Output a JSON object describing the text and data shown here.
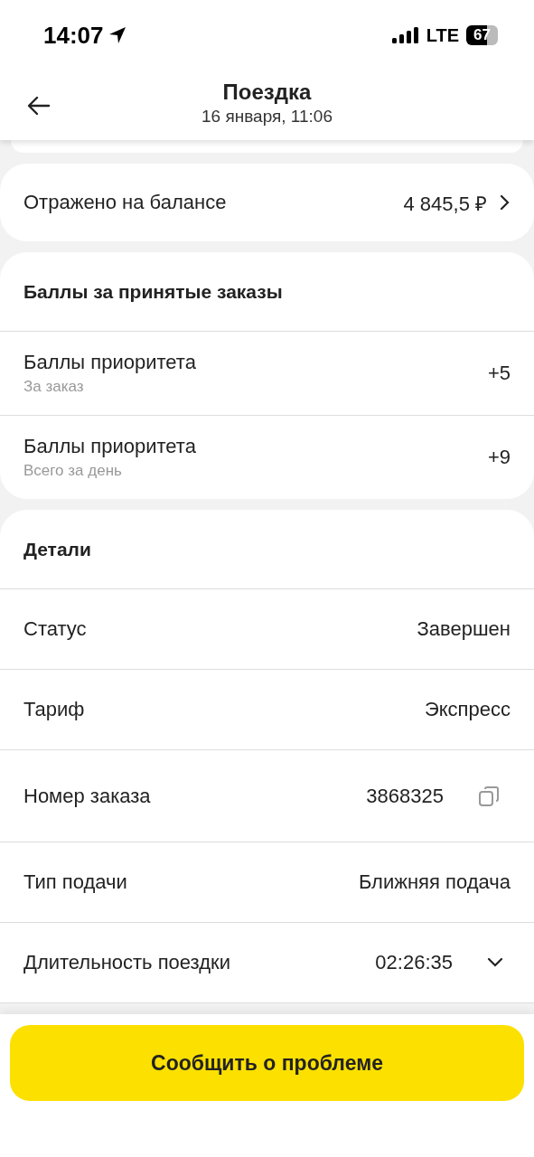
{
  "status_bar": {
    "time": "14:07",
    "network": "LTE",
    "battery": "67"
  },
  "header": {
    "title": "Поездка",
    "subtitle": "16 января, 11:06"
  },
  "balance": {
    "label": "Отражено на балансе",
    "value": "4 845,5 ₽"
  },
  "points": {
    "title": "Баллы за принятые заказы",
    "rows": [
      {
        "label": "Баллы приоритета",
        "hint": "За заказ",
        "value": "+5"
      },
      {
        "label": "Баллы приоритета",
        "hint": "Всего за день",
        "value": "+9"
      }
    ]
  },
  "details": {
    "title": "Детали",
    "rows": [
      {
        "kind": "plain",
        "label": "Статус",
        "value": "Завершен"
      },
      {
        "kind": "plain",
        "label": "Тариф",
        "value": "Экспресс"
      },
      {
        "kind": "copy",
        "label": "Номер заказа",
        "value": "3868325"
      },
      {
        "kind": "plain",
        "label": "Тип подачи",
        "value": "Ближняя подача"
      },
      {
        "kind": "expand",
        "label": "Длительность поездки",
        "value": "02:26:35",
        "expanded": false
      }
    ]
  },
  "report_button": "Сообщить о проблеме"
}
